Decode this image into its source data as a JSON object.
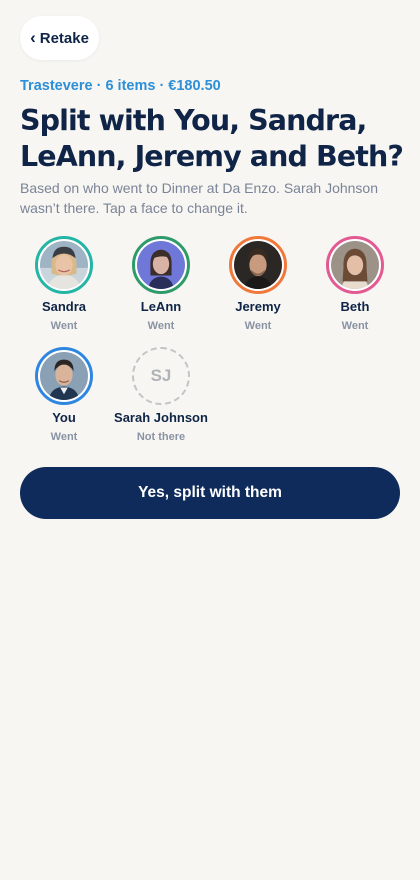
{
  "header": {
    "retake_label": "Retake",
    "meta": "Trastevere · 6 items · €180.50"
  },
  "heading": {
    "title": "Split with You, Sandra, LeAnn, Jeremy and Beth?",
    "subtitle": "Based on who went to Dinner at Da Enzo. Sarah Johnson wasn’t there. Tap a face to change it."
  },
  "people": [
    {
      "name": "Sandra",
      "status": "Went",
      "ring_color": "#24b5a6"
    },
    {
      "name": "LeAnn",
      "status": "Went",
      "ring_color": "#2f9a6a"
    },
    {
      "name": "Jeremy",
      "status": "Went",
      "ring_color": "#f0783a"
    },
    {
      "name": "Beth",
      "status": "Went",
      "ring_color": "#e25a91"
    },
    {
      "name": "You",
      "status": "Went",
      "ring_color": "#2f86e0"
    },
    {
      "name": "Sarah Johnson",
      "status": "Not there",
      "initials": "SJ"
    }
  ],
  "actions": {
    "confirm_label": "Yes, split with them"
  },
  "colors": {
    "background": "#f7f6f2",
    "accent_blue": "#2d8fd8",
    "navy": "#0f2b5b",
    "muted_text": "#7a8497"
  }
}
